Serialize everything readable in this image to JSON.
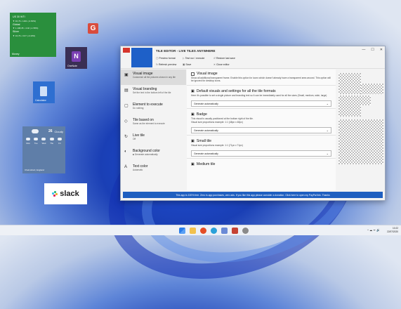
{
  "desktop": {
    "money_tile": {
      "label": "Money",
      "rows": [
        {
          "name": "US 30 WTI",
          "detail": "▼ 46,79 • 1401 (-0.83%)"
        },
        {
          "name": "Global",
          "detail": "▼ 1.198,35 • 4.02 (-1.58%)"
        },
        {
          "name": "Silver",
          "detail": "▼ 16,79 • 0.07 (-0.43%)"
        }
      ]
    },
    "g_tile": {
      "letter": "G"
    },
    "onenote_tile": {
      "label": "OneNote",
      "letter": "N"
    },
    "calculator_tile": {
      "label": "Calculator"
    },
    "weather_tile": {
      "temp": "26",
      "condition": "Cloudy",
      "days": [
        "Mon",
        "Tue",
        "Wed",
        "Thu",
        "Fri"
      ],
      "location": "Chelmsford, England"
    },
    "slack_tile": {
      "label": "slack"
    }
  },
  "window": {
    "title": "TILE EDITOR - LIVE TILES ANYWHERE",
    "toolbar": {
      "preview_format": "Preview format",
      "test_run": "Test run / execute",
      "restore": "Restore last save",
      "refresh": "Refresh preview",
      "save": "Save",
      "close_editor": "Close editor"
    },
    "controls": {
      "minimize": "—",
      "maximize": "☐",
      "close": "✕"
    },
    "sidebar": [
      {
        "title": "Visual image",
        "desc": "Customize all the pictures shown in any tile",
        "icon": "image-icon",
        "glyph": "▣"
      },
      {
        "title": "Visual branding",
        "desc": "Set the text in the bottom left of the tile",
        "icon": "branding-icon",
        "glyph": "▤"
      },
      {
        "title": "Element to execute",
        "desc": "Do nothing",
        "icon": "execute-icon",
        "glyph": "▢"
      },
      {
        "title": "Tile based on",
        "desc": "Same as the element to execute",
        "icon": "based-on-icon",
        "glyph": "◇"
      },
      {
        "title": "Live tile",
        "desc": "Off",
        "icon": "live-tile-icon",
        "glyph": "↻"
      },
      {
        "title": "Background color",
        "desc": "■ Generate automatically",
        "icon": "palette-icon",
        "glyph": "◐"
      },
      {
        "title": "Text color",
        "desc": "Automatic",
        "icon": "text-color-icon",
        "glyph": "A"
      }
    ],
    "content": {
      "visual_image": {
        "heading": "Visual image",
        "text": "Show all additional transparent frame. Enable this option for icons which doesn't already have a transparent area around. This option will be ignored for desktop icons."
      },
      "default_visuals": {
        "heading": "Default visuals and settings for all the tile formats",
        "text": "Here it's possible to set a single picture and branding text so it can be immediately used for all the sizes (Small, medium, wide, large)",
        "select": "Generate automatically"
      },
      "badge": {
        "heading": "Badge",
        "text": "This visual is usually positioned at the bottom right of the tile.",
        "sub": "Visual size proportions example: 1:1 (48px x 48px)",
        "select": "Generate automatically"
      },
      "small_tile": {
        "heading": "Small tile",
        "sub": "Visual size proportions example: 1:1 (71px x 71px)",
        "select": "Generate automatically"
      },
      "medium_tile": {
        "heading": "Medium tile"
      }
    },
    "status": "This app is 100% free. Zero in-app purchases, zero ads. If you like this app please consider a donation. Click here to open my PayPal link. Thanks"
  },
  "taskbar": {
    "time": "10:22",
    "date": "22/07/2020",
    "tray": "^  ☁  ᯤ  🔊"
  },
  "colors": {
    "accent": "#1f5fc0",
    "money": "#2a8f3d",
    "g": "#d94c3d"
  }
}
